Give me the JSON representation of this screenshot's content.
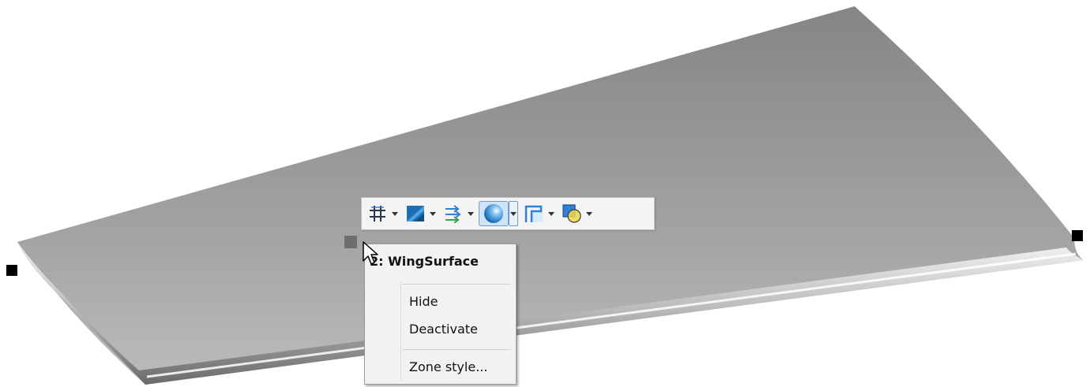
{
  "context_menu": {
    "title": "2: WingSurface",
    "items": [
      {
        "label": "Hide"
      },
      {
        "label": "Deactivate"
      },
      {
        "label": "Zone style..."
      }
    ]
  },
  "toolbar": {
    "buttons": [
      {
        "icon": "mesh-grid-icon",
        "active": false
      },
      {
        "icon": "contour-flood-icon",
        "active": false
      },
      {
        "icon": "vector-arrows-icon",
        "active": false
      },
      {
        "icon": "shade-sphere-icon",
        "active": true
      },
      {
        "icon": "edge-corner-icon",
        "active": false
      },
      {
        "icon": "translucency-overlap-icon",
        "active": false
      }
    ]
  },
  "colors": {
    "accent": "#2f7fd8",
    "selection": "#cfe3f7",
    "surface_dark": "#8c8c8c",
    "surface_light": "#b7b7b7"
  }
}
